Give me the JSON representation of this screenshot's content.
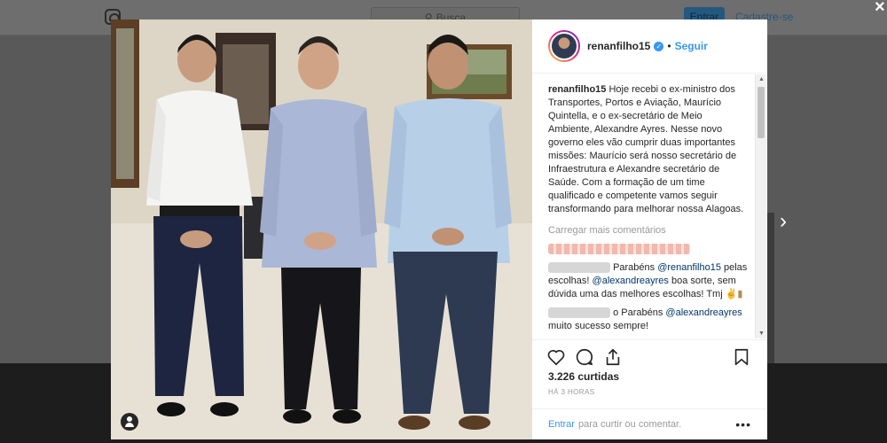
{
  "background": {
    "search_placeholder": "Busca",
    "login_label": "Entrar",
    "signup_label": "Cadastre-se"
  },
  "post": {
    "username": "renanfilho15",
    "follow_label": "Seguir",
    "caption": "Hoje recebi o ex-ministro dos Transportes, Portos e Aviação, Maurício Quintella, e o ex-secretário de Meio Ambiente, Alexandre Ayres. Nesse novo governo eles vão cumprir duas importantes missões: Maurício será nosso secretário de Infraestrutura e Alexandre secretário de Saúde. Com a formação de um time qualificado e competente vamos seguir transformando para melhorar nossa Alagoas.",
    "load_more": "Carregar mais comentários",
    "comments": [
      {
        "prefix": "",
        "text_1": "Parabéns ",
        "mention_1": "@renanfilho15",
        "text_2": " pelas escolhas! ",
        "mention_2": "@alexandreayres",
        "text_3": " boa sorte, sem dúvida uma das melhores escolhas! Tmj"
      },
      {
        "prefix": "o",
        "text_1": "Parabéns ",
        "mention_1": "@alexandreayres",
        "text_2": " muito sucesso sempre!"
      }
    ],
    "likes": "3.226 curtidas",
    "time": "HÁ 3 HORAS",
    "footer_login": "Entrar",
    "footer_text": "para curtir ou comentar."
  },
  "icons": {
    "close": "close-icon",
    "next": "chevron-right-icon",
    "like": "heart-icon",
    "comment": "comment-icon",
    "share": "share-icon",
    "save": "bookmark-icon",
    "options": "more-options-icon"
  },
  "colors": {
    "link": "#3897f0",
    "mention": "#003569",
    "verified": "#3897f0"
  }
}
